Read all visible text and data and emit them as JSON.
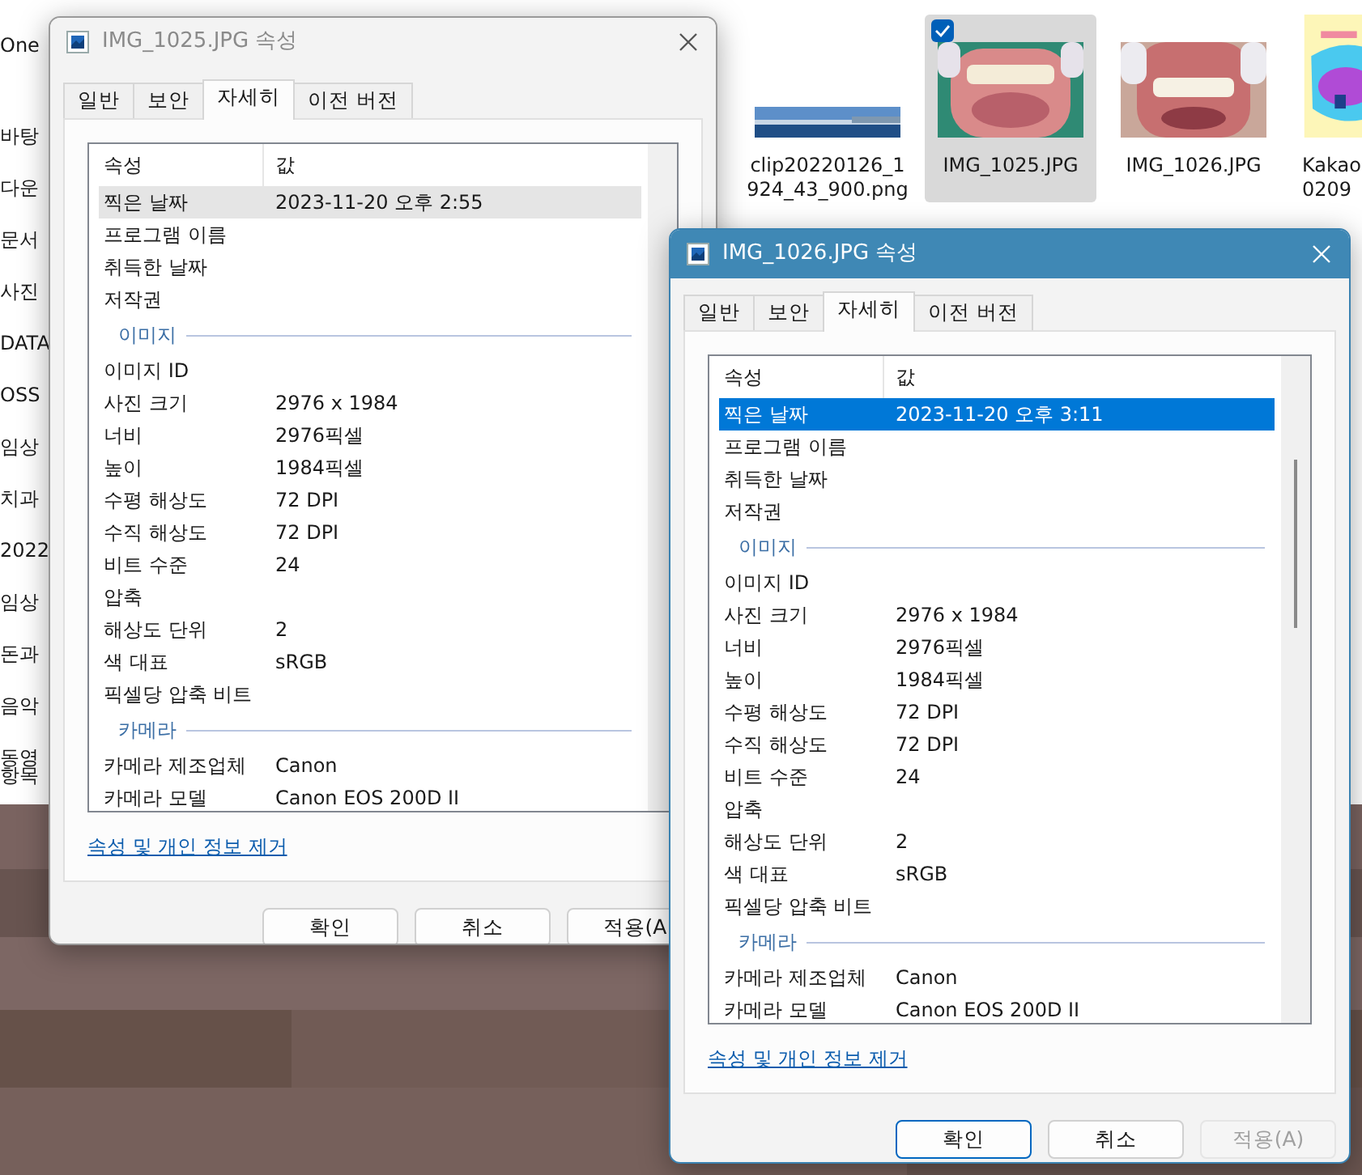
{
  "explorer": {
    "sidebar_items": [
      "One",
      "바탕",
      "다운",
      "문서",
      "사진",
      "DATA",
      "OSS",
      "임상",
      "치과",
      "2022",
      "임상",
      "돈과",
      "음악",
      "동영"
    ],
    "status_text": "항목",
    "files": [
      {
        "lines": [
          "clip20220126_1",
          "924_43_900.png"
        ],
        "selected": false,
        "checked": false
      },
      {
        "lines": [
          "IMG_1025.JPG"
        ],
        "selected": true,
        "checked": true
      },
      {
        "lines": [
          "IMG_1026.JPG"
        ],
        "selected": false,
        "checked": false
      },
      {
        "lines": [
          "Kakao",
          "0209"
        ],
        "selected": false,
        "checked": false
      }
    ]
  },
  "dialogs": [
    {
      "title": "IMG_1025.JPG 속성",
      "active": false,
      "tabs": [
        {
          "label": "일반",
          "selected": false
        },
        {
          "label": "보안",
          "selected": false
        },
        {
          "label": "자세히",
          "selected": true
        },
        {
          "label": "이전 버전",
          "selected": false
        }
      ],
      "columns": [
        "속성",
        "값"
      ],
      "rows": [
        {
          "kind": "property",
          "name": "찍은 날짜",
          "value": "2023-11-20 오후 2:55",
          "selected": true
        },
        {
          "kind": "property",
          "name": "프로그램 이름",
          "selected": false
        },
        {
          "kind": "property",
          "name": "취득한 날짜",
          "selected": false
        },
        {
          "kind": "property",
          "name": "저작권",
          "selected": false
        },
        {
          "kind": "section",
          "name": "이미지"
        },
        {
          "kind": "property",
          "name": "이미지 ID",
          "selected": false
        },
        {
          "kind": "property",
          "name": "사진 크기",
          "value": "2976 x 1984",
          "selected": false
        },
        {
          "kind": "property",
          "name": "너비",
          "value": "2976픽셀",
          "selected": false
        },
        {
          "kind": "property",
          "name": "높이",
          "value": "1984픽셀",
          "selected": false
        },
        {
          "kind": "property",
          "name": "수평 해상도",
          "value": "72 DPI",
          "selected": false
        },
        {
          "kind": "property",
          "name": "수직 해상도",
          "value": "72 DPI",
          "selected": false
        },
        {
          "kind": "property",
          "name": "비트 수준",
          "value": "24",
          "selected": false
        },
        {
          "kind": "property",
          "name": "압축",
          "selected": false
        },
        {
          "kind": "property",
          "name": "해상도 단위",
          "value": "2",
          "selected": false
        },
        {
          "kind": "property",
          "name": "색 대표",
          "value": "sRGB",
          "selected": false
        },
        {
          "kind": "property",
          "name": "픽셀당 압축 비트",
          "selected": false
        },
        {
          "kind": "section",
          "name": "카메라"
        },
        {
          "kind": "property",
          "name": "카메라 제조업체",
          "value": "Canon",
          "selected": false
        },
        {
          "kind": "property",
          "name": "카메라 모델",
          "value": "Canon EOS 200D II",
          "selected": false
        }
      ],
      "link": "속성 및 개인 정보 제거",
      "buttons": [
        {
          "label": "확인",
          "default": false,
          "disabled": false
        },
        {
          "label": "취소",
          "default": false,
          "disabled": false
        },
        {
          "label": "적용(A",
          "default": false,
          "disabled": false
        }
      ]
    },
    {
      "title": "IMG_1026.JPG 속성",
      "active": true,
      "tabs": [
        {
          "label": "일반",
          "selected": false
        },
        {
          "label": "보안",
          "selected": false
        },
        {
          "label": "자세히",
          "selected": true
        },
        {
          "label": "이전 버전",
          "selected": false
        }
      ],
      "columns": [
        "속성",
        "값"
      ],
      "rows": [
        {
          "kind": "property",
          "name": "찍은 날짜",
          "value": "2023-11-20 오후 3:11",
          "selected": true
        },
        {
          "kind": "property",
          "name": "프로그램 이름",
          "selected": false
        },
        {
          "kind": "property",
          "name": "취득한 날짜",
          "selected": false
        },
        {
          "kind": "property",
          "name": "저작권",
          "selected": false
        },
        {
          "kind": "section",
          "name": "이미지"
        },
        {
          "kind": "property",
          "name": "이미지 ID",
          "selected": false
        },
        {
          "kind": "property",
          "name": "사진 크기",
          "value": "2976 x 1984",
          "selected": false
        },
        {
          "kind": "property",
          "name": "너비",
          "value": "2976픽셀",
          "selected": false
        },
        {
          "kind": "property",
          "name": "높이",
          "value": "1984픽셀",
          "selected": false
        },
        {
          "kind": "property",
          "name": "수평 해상도",
          "value": "72 DPI",
          "selected": false
        },
        {
          "kind": "property",
          "name": "수직 해상도",
          "value": "72 DPI",
          "selected": false
        },
        {
          "kind": "property",
          "name": "비트 수준",
          "value": "24",
          "selected": false
        },
        {
          "kind": "property",
          "name": "압축",
          "selected": false
        },
        {
          "kind": "property",
          "name": "해상도 단위",
          "value": "2",
          "selected": false
        },
        {
          "kind": "property",
          "name": "색 대표",
          "value": "sRGB",
          "selected": false
        },
        {
          "kind": "property",
          "name": "픽셀당 압축 비트",
          "selected": false
        },
        {
          "kind": "section",
          "name": "카메라"
        },
        {
          "kind": "property",
          "name": "카메라 제조업체",
          "value": "Canon",
          "selected": false
        },
        {
          "kind": "property",
          "name": "카메라 모델",
          "value": "Canon EOS 200D II",
          "selected": false
        }
      ],
      "link": "속성 및 개인 정보 제거",
      "buttons": [
        {
          "label": "확인",
          "default": true,
          "disabled": false
        },
        {
          "label": "취소",
          "default": false,
          "disabled": false
        },
        {
          "label": "적용(A)",
          "default": false,
          "disabled": true
        }
      ]
    }
  ]
}
